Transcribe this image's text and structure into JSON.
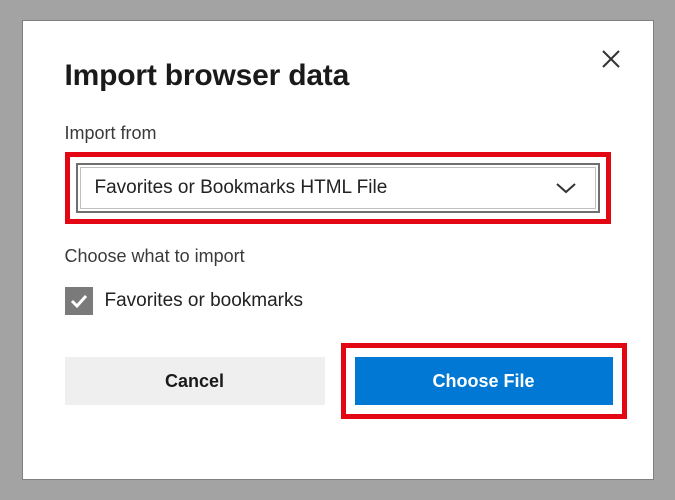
{
  "dialog": {
    "title": "Import browser data",
    "import_from_label": "Import from",
    "dropdown_value": "Favorites or Bookmarks HTML File",
    "choose_label": "Choose what to import",
    "checkbox_item": "Favorites or bookmarks",
    "checkbox_checked": true,
    "cancel_label": "Cancel",
    "primary_label": "Choose File"
  }
}
